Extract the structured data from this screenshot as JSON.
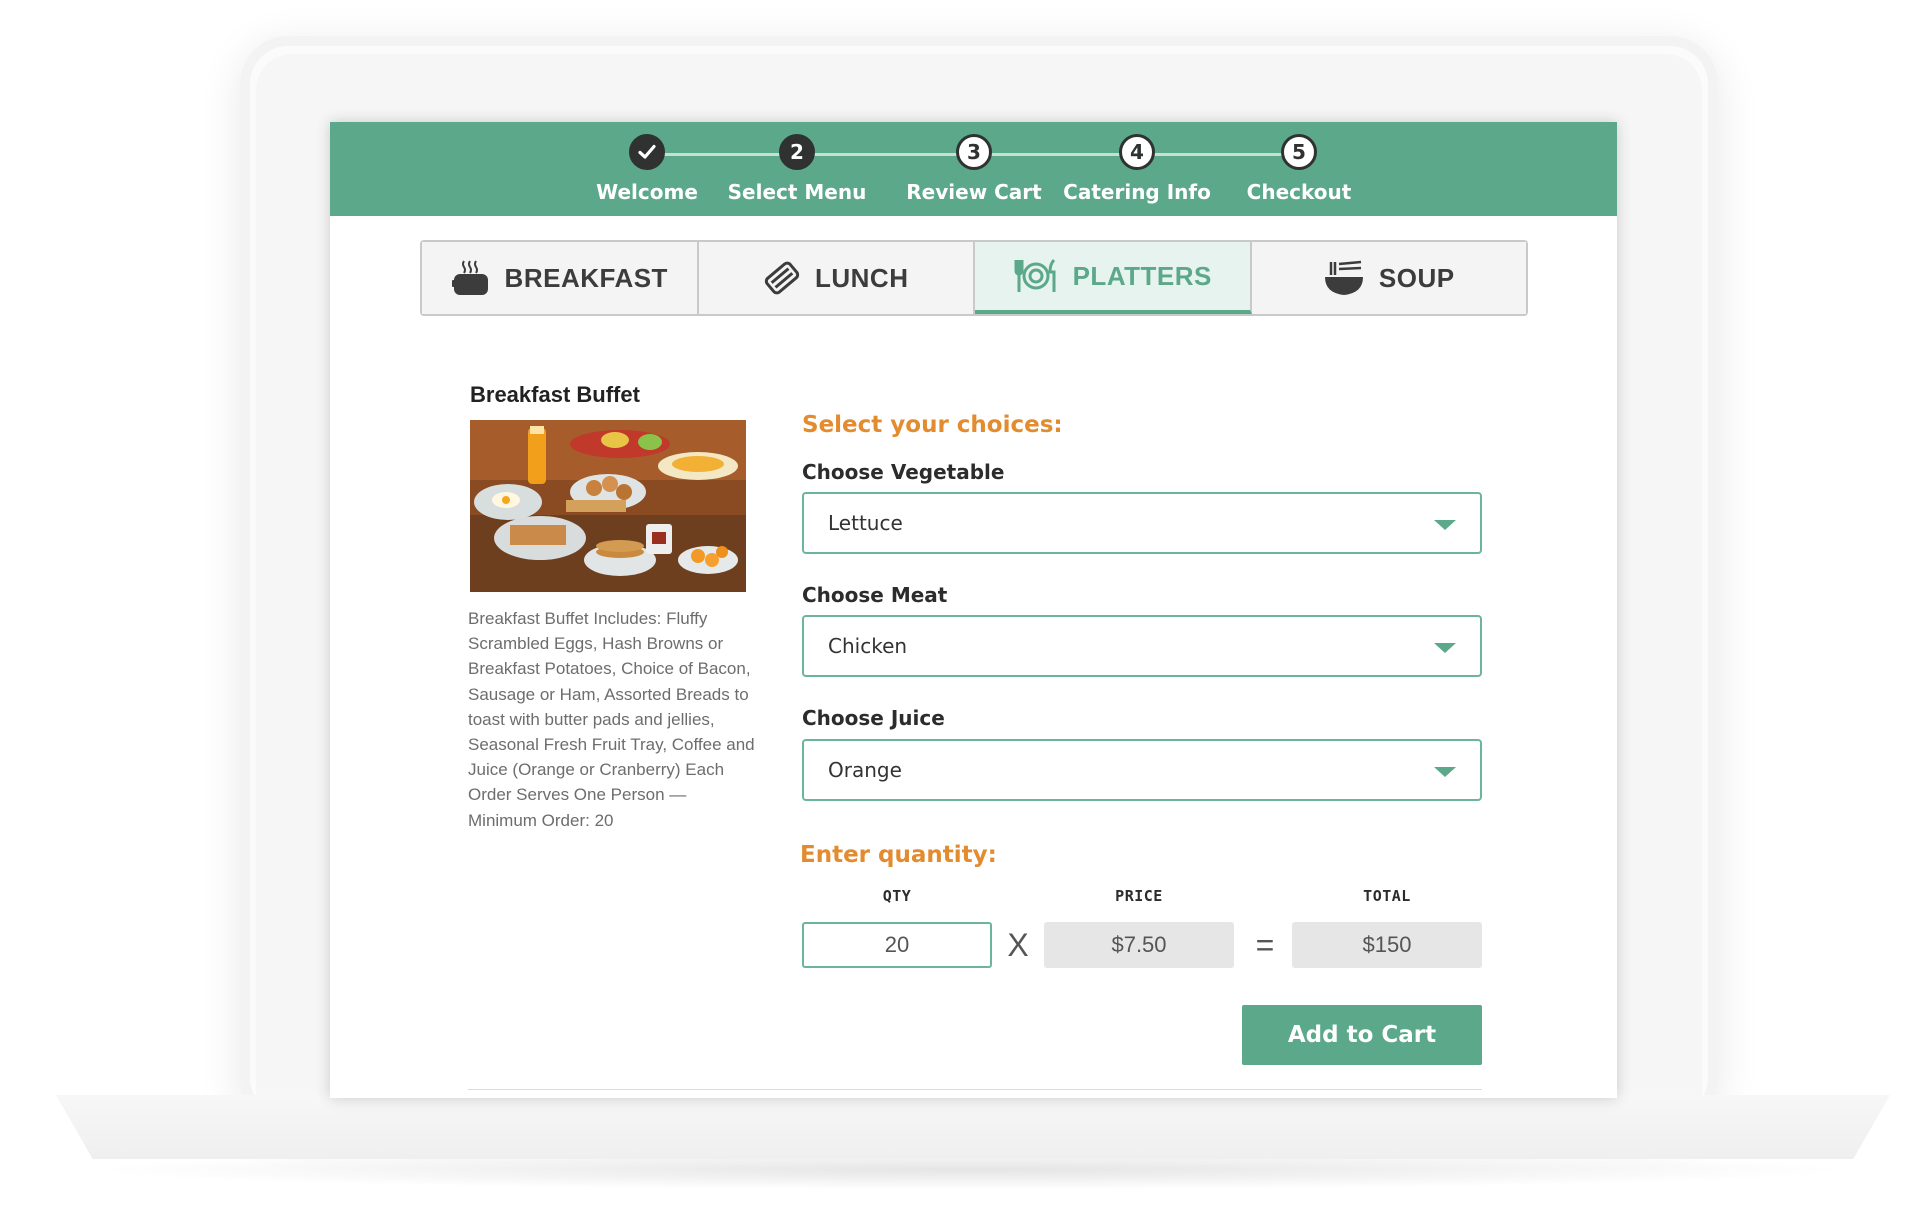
{
  "steps": [
    {
      "number": "✓",
      "label": "Welcome",
      "state": "done"
    },
    {
      "number": "2",
      "label": "Select Menu",
      "state": "active"
    },
    {
      "number": "3",
      "label": "Review Cart",
      "state": "todo"
    },
    {
      "number": "4",
      "label": "Catering Info",
      "state": "todo"
    },
    {
      "number": "5",
      "label": "Checkout",
      "state": "todo"
    }
  ],
  "tabs": [
    {
      "label": "BREAKFAST",
      "icon": "toaster-icon"
    },
    {
      "label": "LUNCH",
      "icon": "sandwich-icon"
    },
    {
      "label": "PLATTERS",
      "icon": "plate-fork-knife-icon",
      "active": true
    },
    {
      "label": "SOUP",
      "icon": "soup-bowl-icon"
    }
  ],
  "product": {
    "title": "Breakfast Buffet",
    "image": "breakfast-buffet-photo",
    "description": "Breakfast Buffet Includes: Fluffy Scrambled Eggs, Hash Browns or Breakfast Potatoes, Choice of Bacon, Sausage or Ham, Assorted Breads to toast with butter pads and jellies, Seasonal Fresh Fruit Tray, Coffee and Juice (Orange or Cranberry) Each Order Serves One Person — Minimum Order: 20"
  },
  "choices": {
    "heading": "Select your choices:",
    "vegetable": {
      "label": "Choose Vegetable",
      "value": "Lettuce"
    },
    "meat": {
      "label": "Choose Meat",
      "value": "Chicken"
    },
    "juice": {
      "label": "Choose Juice",
      "value": "Orange"
    }
  },
  "quantity": {
    "heading": "Enter quantity:",
    "qty_label": "QTY",
    "price_label": "PRICE",
    "total_label": "TOTAL",
    "qty": "20",
    "times": "X",
    "price": "$7.50",
    "equals": "=",
    "total": "$150"
  },
  "add_button": "Add to Cart",
  "colors": {
    "brand_green": "#5ba88a",
    "accent_orange": "#e38b2f",
    "step_dark": "#2f3230"
  }
}
